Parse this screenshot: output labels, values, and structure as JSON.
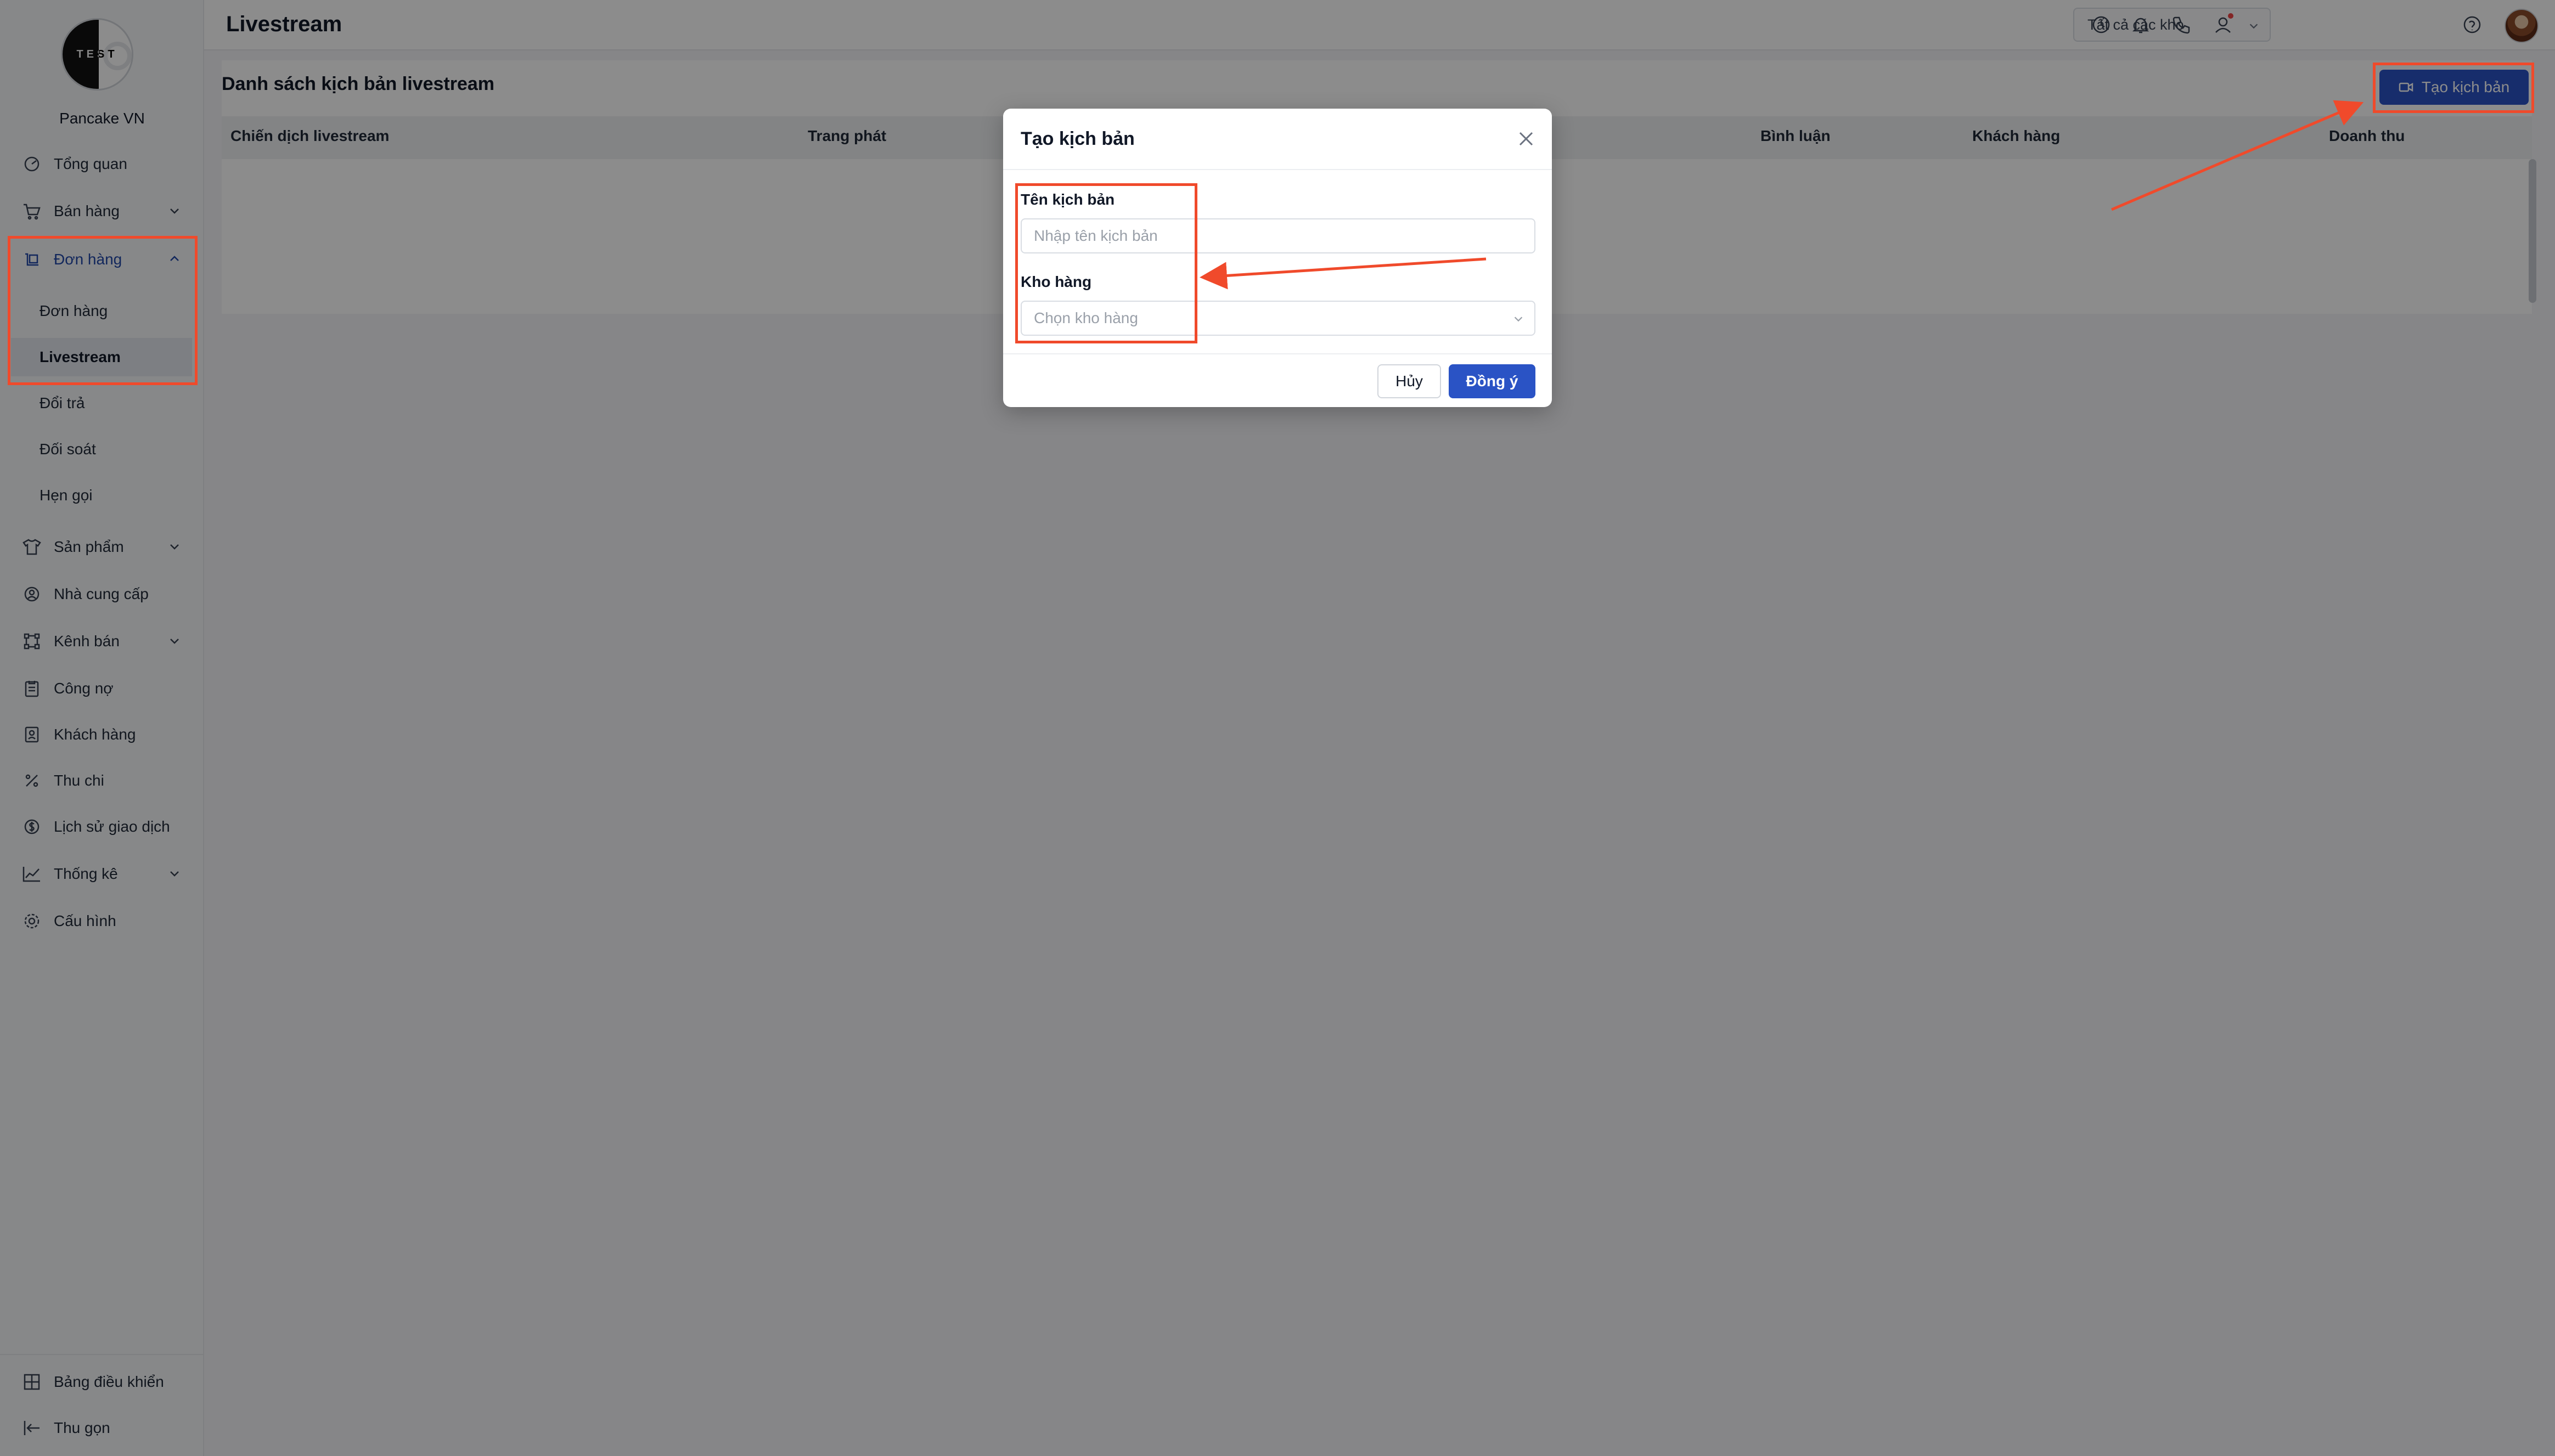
{
  "app": {
    "title": "Livestream",
    "brand": "Pancake VN",
    "logo_text": "TEST"
  },
  "colors": {
    "primary": "#2a53c5",
    "annotation": "#f04a2b",
    "overlay": "rgba(0,0,0,0.45)"
  },
  "header": {
    "warehouse_select": "Tất cả các kho",
    "icons": [
      "clock-icon",
      "bell-icon",
      "phone-icon",
      "user-icon",
      "help-icon",
      "avatar"
    ]
  },
  "sidebar": {
    "items": [
      {
        "label": "Tổng quan",
        "icon": "dashboard-icon"
      },
      {
        "label": "Bán hàng",
        "icon": "cart-icon",
        "expandable": true
      },
      {
        "label": "Đơn hàng",
        "icon": "orders-icon",
        "expandable": true,
        "open": true
      },
      {
        "label": "Sản phẩm",
        "icon": "shirt-icon",
        "expandable": true
      },
      {
        "label": "Nhà cung cấp",
        "icon": "supplier-icon"
      },
      {
        "label": "Kênh bán",
        "icon": "channel-icon",
        "expandable": true
      },
      {
        "label": "Công nợ",
        "icon": "debt-icon"
      },
      {
        "label": "Khách hàng",
        "icon": "customer-icon"
      },
      {
        "label": "Thu chi",
        "icon": "percent-icon"
      },
      {
        "label": "Lịch sử giao dịch",
        "icon": "dollar-icon"
      },
      {
        "label": "Thống kê",
        "icon": "chart-icon",
        "expandable": true
      },
      {
        "label": "Cấu hình",
        "icon": "gear-icon"
      }
    ],
    "sub_items": [
      "Đơn hàng",
      "Livestream",
      "Đổi trả",
      "Đối soát",
      "Hẹn gọi"
    ],
    "active_sub": "Livestream",
    "footer": [
      {
        "label": "Bảng điều khiển",
        "icon": "grid-icon"
      },
      {
        "label": "Thu gọn",
        "icon": "collapse-icon"
      }
    ]
  },
  "main": {
    "list_title": "Danh sách kịch bản livestream",
    "create_button": "Tạo kịch bản",
    "columns": [
      "Chiến dịch livestream",
      "Trang phát",
      "Bình luận",
      "Khách hàng",
      "Doanh thu"
    ]
  },
  "modal": {
    "title": "Tạo kịch bản",
    "fields": [
      {
        "label": "Tên kịch bản",
        "placeholder": "Nhập tên kịch bản"
      },
      {
        "label": "Kho hàng",
        "placeholder": "Chọn kho hàng"
      }
    ],
    "cancel": "Hủy",
    "confirm": "Đồng ý"
  }
}
